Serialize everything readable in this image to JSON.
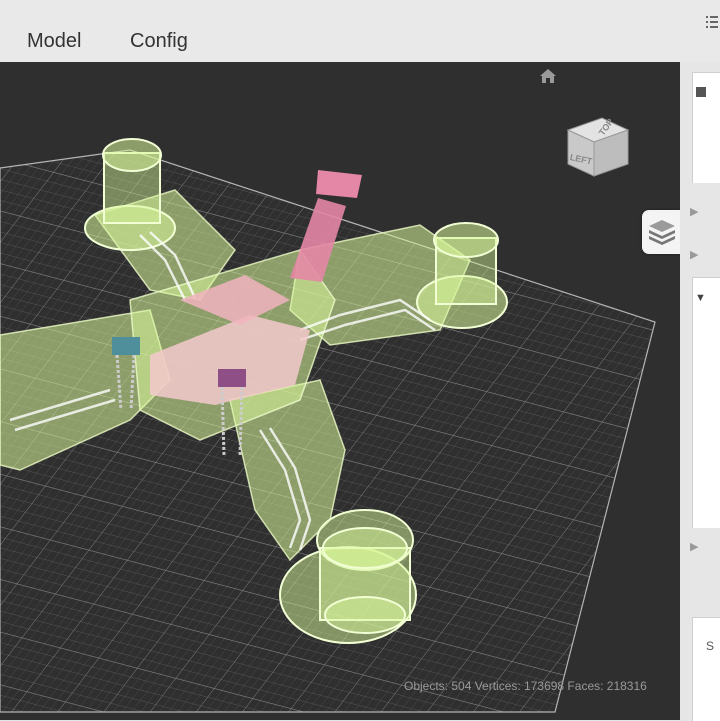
{
  "tabs": [
    {
      "label": "Model"
    },
    {
      "label": "Config"
    }
  ],
  "viewcube": {
    "top": "TOP",
    "left": "LEFT"
  },
  "stats": {
    "text": "Objects: 504 Vertices: 173698 Faces: 218316"
  },
  "right_panel": {
    "truncated_label": "S"
  },
  "colors": {
    "viewport_bg": "#2f2f2f",
    "frame_green": "#d8f79a",
    "pink": "#e487a6",
    "teal": "#4f8f9b",
    "purple": "#8d4f86"
  },
  "icons": [
    "home-icon",
    "layers-icon",
    "menu-icon",
    "chevron-right-icon",
    "chevron-down-icon"
  ]
}
